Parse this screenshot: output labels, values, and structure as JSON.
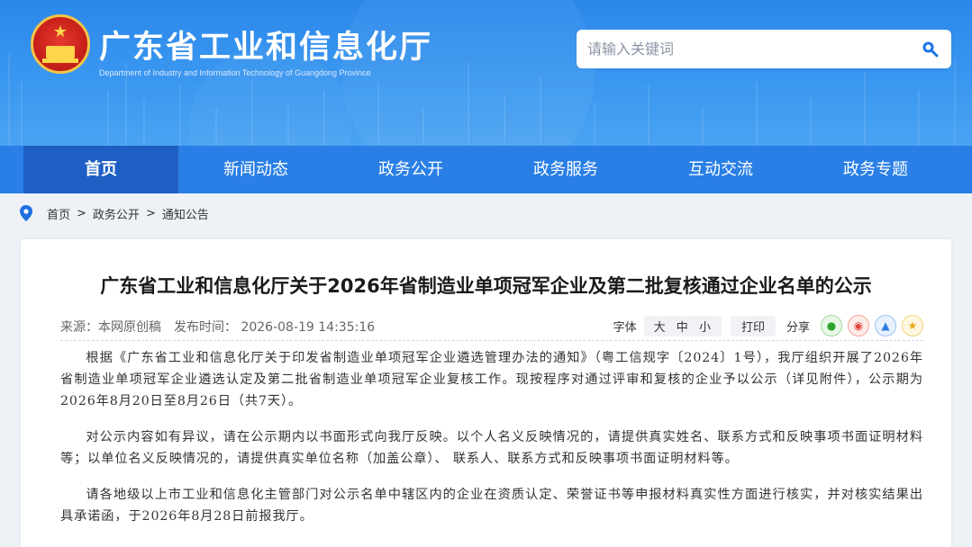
{
  "header": {
    "title": "广东省工业和信息化厅",
    "subtitle": "Department of Industry and Information Technology of Guangdong Province",
    "search_placeholder": "请输入关键词",
    "search_icon": "search-icon"
  },
  "nav": {
    "items": [
      {
        "label": "首页"
      },
      {
        "label": "新闻动态"
      },
      {
        "label": "政务公开"
      },
      {
        "label": "政务服务"
      },
      {
        "label": "互动交流"
      },
      {
        "label": "政务专题"
      }
    ]
  },
  "breadcrumb": {
    "items": [
      "首页",
      "政务公开",
      "通知公告"
    ],
    "separator": ">"
  },
  "article": {
    "title": "广东省工业和信息化厅关于2026年省制造业单项冠军企业及第二批复核通过企业名单的公示",
    "source_label": "来源：本网原创稿",
    "date_label": "发布时间：",
    "date": "2026-08-19 14:35:16",
    "font_label": "字体",
    "font_sizes": [
      "大",
      "中",
      "小"
    ],
    "print_label": "打印",
    "share_label": "分享",
    "paragraphs": [
      "根据《广东省工业和信息化厅关于印发省制造业单项冠军企业遴选管理办法的通知》（粤工信规字〔2024〕1号），我厅组织开展了2026年省制造业单项冠军企业遴选认定及第二批省制造业单项冠军企业复核工作。现按程序对通过评审和复核的企业予以公示（详见附件），公示期为2026年8月20日至8月26日（共7天）。",
      "对公示内容如有异议，请在公示期内以书面形式向我厅反映。以个人名义反映情况的，请提供真实姓名、联系方式和反映事项书面证明材料等；以单位名义反映情况的，请提供真实单位名称（加盖公章）、 联系人、联系方式和反映事项书面证明材料等。",
      "请各地级以上市工业和信息化主管部门对公示名单中辖区内的企业在资质认定、荣誉证书等申报材料真实性方面进行核实，并对核实结果出具承诺函，于2026年8月28日前报我厅。"
    ]
  },
  "colors": {
    "header_blue": "#3a97f0",
    "nav_blue": "#2a7fe6",
    "nav_active": "#1e5fc4",
    "page_bg": "#eef1f6"
  }
}
